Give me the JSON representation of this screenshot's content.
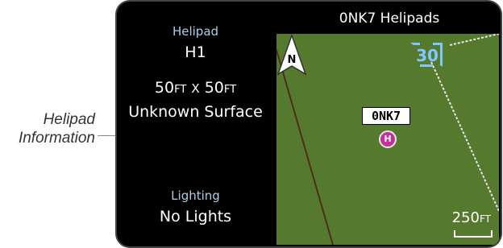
{
  "callout": {
    "line1": "Helipad",
    "line2": "Information"
  },
  "screen": {
    "title": "0NK7 Helipads",
    "info": {
      "helipad_label": "Helipad",
      "helipad_value": "H1",
      "dim_width": "50",
      "dim_width_unit": "FT",
      "dim_sep": "X",
      "dim_length": "50",
      "dim_length_unit": "FT",
      "surface": "Unknown Surface",
      "lighting_label": "Lighting",
      "lighting_value": "No Lights"
    },
    "map": {
      "north_letter": "N",
      "heading": "30",
      "airport_ident": "0NK7",
      "helipad_symbol": "H",
      "scale_value": "250",
      "scale_unit": "FT",
      "colors": {
        "terrain": "#557a2e",
        "heading": "#7fc8ff",
        "helipad": "#c0339b"
      }
    }
  }
}
